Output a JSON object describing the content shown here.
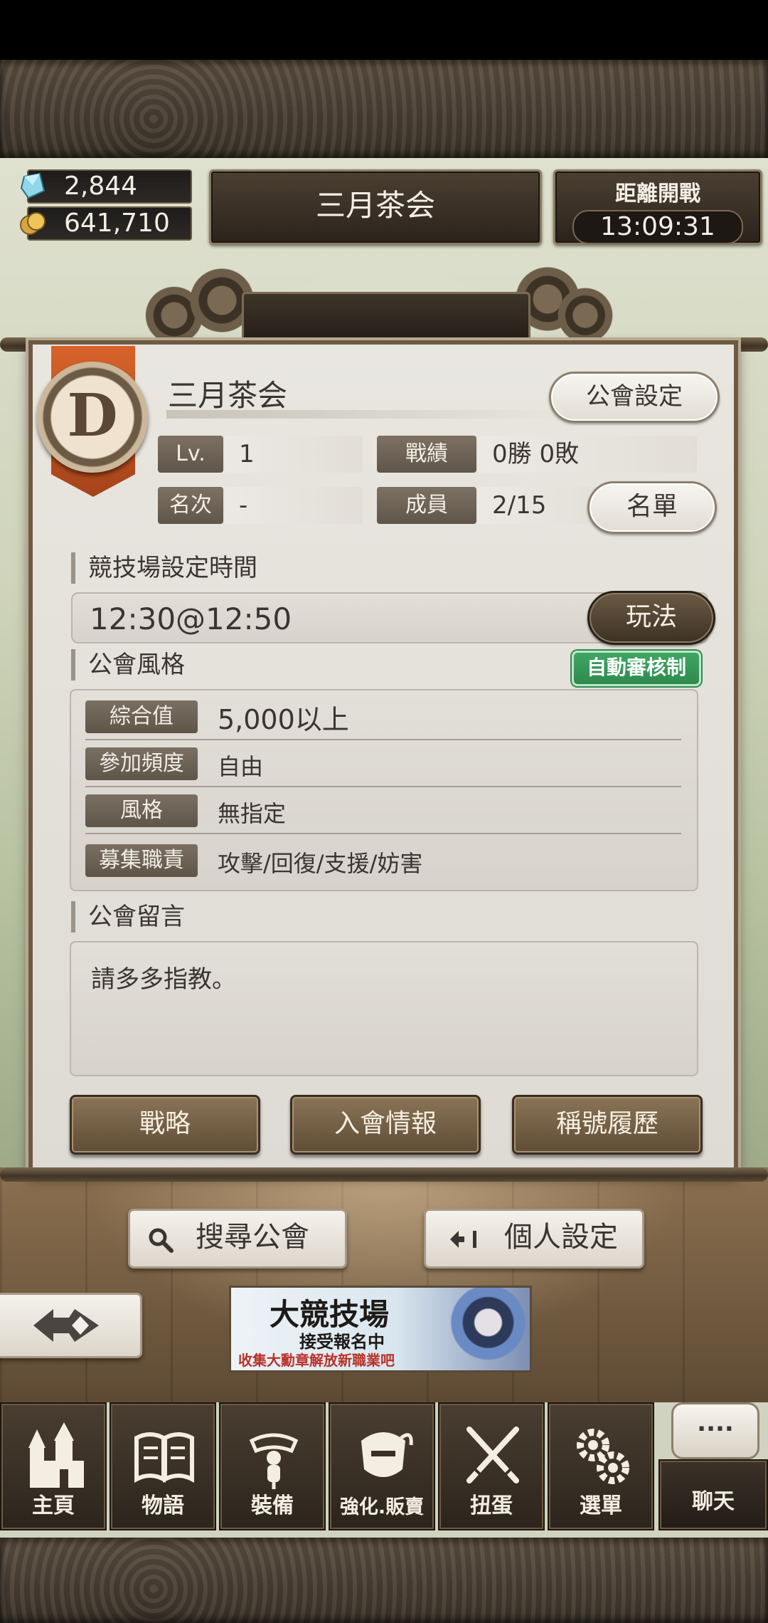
{
  "currency": {
    "gems": "2,844",
    "gold": "641,710"
  },
  "header": {
    "guild_name": "三月茶会",
    "countdown_label": "距離開戰",
    "countdown_time": "13:09:31"
  },
  "guild": {
    "rank_letter": "D",
    "name": "三月茶会",
    "settings_button": "公會設定",
    "level_label": "Lv.",
    "level_value": "1",
    "record_label": "戰績",
    "record_value": "0勝 0敗",
    "ranking_label": "名次",
    "ranking_value": "-",
    "members_label": "成員",
    "members_value": "2/15",
    "roster_button": "名單"
  },
  "arena": {
    "section_title": "競技場設定時間",
    "time_value": "12:30@12:50",
    "rules_button": "玩法"
  },
  "style": {
    "section_title": "公會風格",
    "auto_review_badge": "自動審核制",
    "rows": [
      {
        "label": "綜合值",
        "value": "5,000以上"
      },
      {
        "label": "參加頻度",
        "value": "自由"
      },
      {
        "label": "風格",
        "value": "無指定"
      },
      {
        "label": "募集職責",
        "value": "攻擊/回復/支援/妨害"
      }
    ]
  },
  "message": {
    "section_title": "公會留言",
    "text": "請多多指教。"
  },
  "actions": {
    "strategy": "戰略",
    "join_info": "入會情報",
    "title_history": "稱號履歷"
  },
  "lower": {
    "search_guild": "搜尋公會",
    "personal_settings": "個人設定"
  },
  "banner": {
    "title": "大競技場",
    "subtitle": "接受報名中",
    "tagline": "收集大勳章解放新職業吧"
  },
  "nav": {
    "home": "主頁",
    "story": "物語",
    "equipment": "裝備",
    "enhance_sell": "強化.販賣",
    "gacha": "扭蛋",
    "menu": "選單",
    "chat": "聊天",
    "chat_bubble": "...."
  },
  "colors": {
    "panel_border": "#6e5a44",
    "auto_review_green": "#2f8a4e",
    "button_brown": "#7a6548"
  }
}
